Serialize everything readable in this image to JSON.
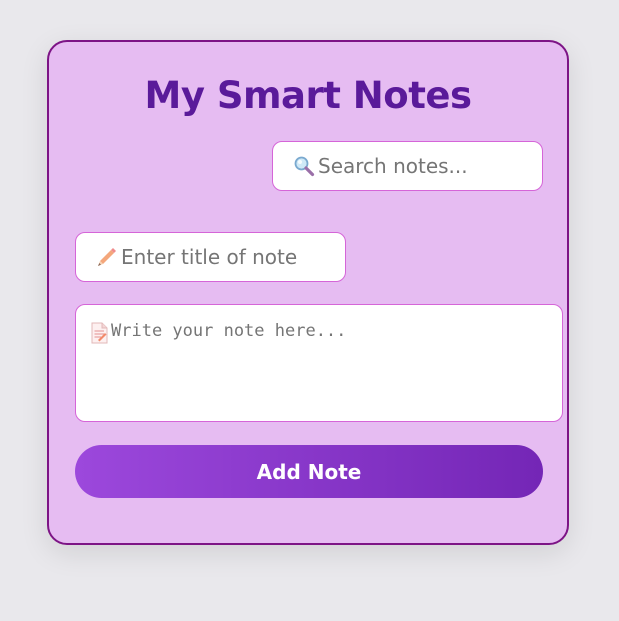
{
  "app": {
    "title": "My Smart Notes"
  },
  "search": {
    "icon": "magnifier-icon",
    "placeholder": "Search notes..."
  },
  "note_title": {
    "icon": "pencil-icon",
    "placeholder": "Enter title of note"
  },
  "note_body": {
    "icon": "memo-icon",
    "placeholder": "Write your note here..."
  },
  "actions": {
    "add_label": "Add Note"
  },
  "colors": {
    "background": "#e9e8ec",
    "card": "#e6bcf2",
    "card_border": "#7d1486",
    "title": "#5a1a9a",
    "field_border": "#d565d8",
    "button_start": "#9c48dc",
    "button_end": "#7426b6"
  }
}
